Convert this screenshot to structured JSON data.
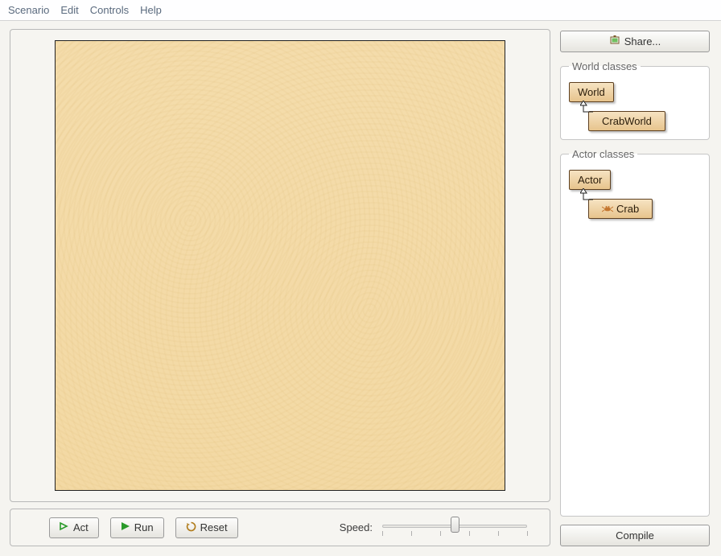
{
  "menu": {
    "scenario": "Scenario",
    "edit": "Edit",
    "controls": "Controls",
    "help": "Help"
  },
  "buttons": {
    "share": "Share...",
    "act": "Act",
    "run": "Run",
    "reset": "Reset",
    "compile": "Compile"
  },
  "speed": {
    "label": "Speed:"
  },
  "world_classes": {
    "legend": "World classes",
    "root": "World",
    "child": "CrabWorld"
  },
  "actor_classes": {
    "legend": "Actor classes",
    "root": "Actor",
    "child": "Crab"
  }
}
